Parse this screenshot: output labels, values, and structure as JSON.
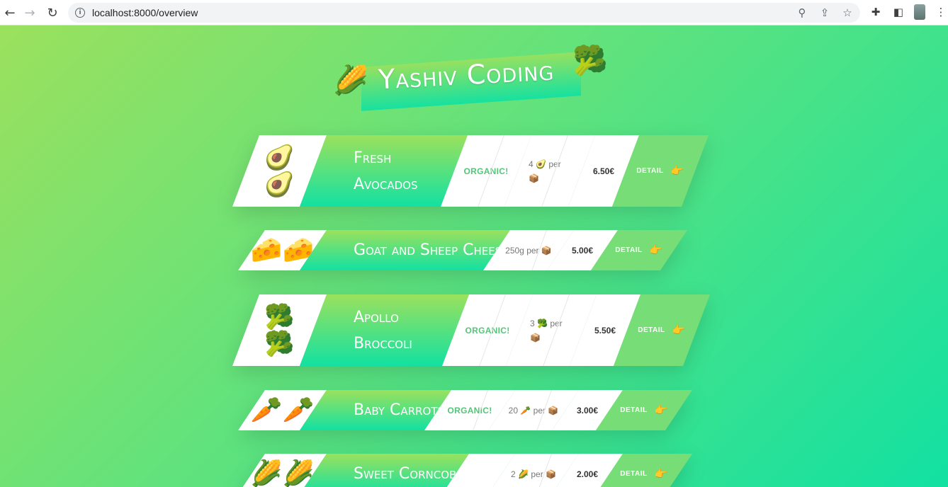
{
  "browser": {
    "url": "localhost:8000/overview"
  },
  "header": {
    "title": "Yashiv Coding",
    "left_icon": "corn-icon",
    "right_icon": "broccoli-icon"
  },
  "products": [
    {
      "name": "Fresh Avocados",
      "name_line1": "Fresh",
      "name_line2": "Avocados",
      "image": "🥑",
      "organic": "ORGANIC!",
      "qty_count": "4",
      "qty_icon": "🥑",
      "qty_per": "per",
      "price": "6.50€",
      "detail": "DETAIL"
    },
    {
      "name": "Goat and Sheep Cheese",
      "image": "🧀",
      "organic": "",
      "qty_count": "250g",
      "qty_per": "per",
      "price": "5.00€",
      "detail": "DETAIL"
    },
    {
      "name": "Apollo Broccoli",
      "name_line1": "Apollo",
      "name_line2": "Broccoli",
      "image": "🥦",
      "organic": "ORGANIC!",
      "qty_count": "3",
      "qty_icon": "🥦",
      "qty_per": "per",
      "price": "5.50€",
      "detail": "DETAIL"
    },
    {
      "name": "Baby Carrots",
      "image": "🥕",
      "organic": "ORGANIC!",
      "qty_count": "20",
      "qty_icon": "🥕",
      "qty_per": "per",
      "price": "3.00€",
      "detail": "DETAIL"
    },
    {
      "name": "Sweet Corncobs",
      "image": "🌽",
      "organic": "",
      "qty_count": "2",
      "qty_icon": "🌽",
      "qty_per": "per",
      "price": "2.00€",
      "detail": "DETAIL"
    }
  ]
}
